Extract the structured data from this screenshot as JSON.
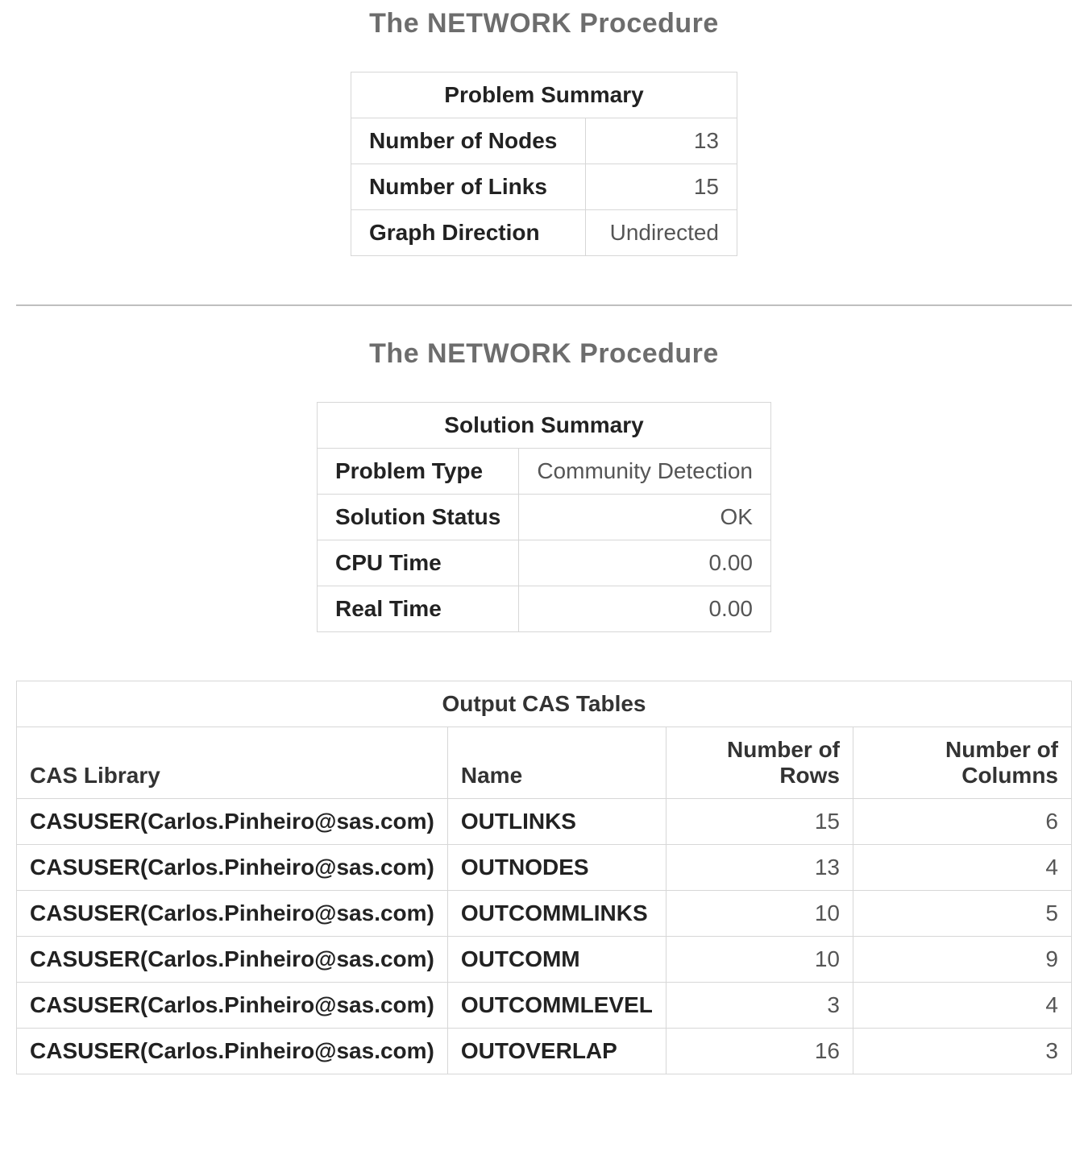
{
  "section1": {
    "title": "The NETWORK Procedure",
    "problem_summary": {
      "caption": "Problem Summary",
      "rows": [
        {
          "label": "Number of Nodes",
          "value": "13"
        },
        {
          "label": "Number of Links",
          "value": "15"
        },
        {
          "label": "Graph Direction",
          "value": "Undirected"
        }
      ]
    }
  },
  "section2": {
    "title": "The NETWORK Procedure",
    "solution_summary": {
      "caption": "Solution Summary",
      "rows": [
        {
          "label": "Problem Type",
          "value": "Community Detection"
        },
        {
          "label": "Solution Status",
          "value": "OK"
        },
        {
          "label": "CPU Time",
          "value": "0.00"
        },
        {
          "label": "Real Time",
          "value": "0.00"
        }
      ]
    },
    "output_cas_tables": {
      "caption": "Output CAS Tables",
      "columns": {
        "cas_library": "CAS Library",
        "name": "Name",
        "num_rows": "Number of Rows",
        "num_cols": "Number of Columns"
      },
      "rows": [
        {
          "lib": "CASUSER(Carlos.Pinheiro@sas.com)",
          "name": "OUTLINKS",
          "nrows": "15",
          "ncols": "6"
        },
        {
          "lib": "CASUSER(Carlos.Pinheiro@sas.com)",
          "name": "OUTNODES",
          "nrows": "13",
          "ncols": "4"
        },
        {
          "lib": "CASUSER(Carlos.Pinheiro@sas.com)",
          "name": "OUTCOMMLINKS",
          "nrows": "10",
          "ncols": "5"
        },
        {
          "lib": "CASUSER(Carlos.Pinheiro@sas.com)",
          "name": "OUTCOMM",
          "nrows": "10",
          "ncols": "9"
        },
        {
          "lib": "CASUSER(Carlos.Pinheiro@sas.com)",
          "name": "OUTCOMMLEVEL",
          "nrows": "3",
          "ncols": "4"
        },
        {
          "lib": "CASUSER(Carlos.Pinheiro@sas.com)",
          "name": "OUTOVERLAP",
          "nrows": "16",
          "ncols": "3"
        }
      ]
    }
  }
}
